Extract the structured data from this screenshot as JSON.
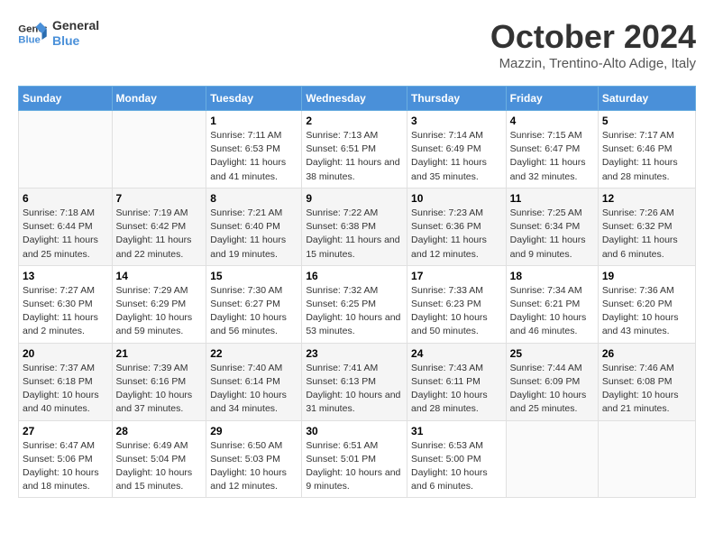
{
  "logo": {
    "line1": "General",
    "line2": "Blue"
  },
  "title": "October 2024",
  "location": "Mazzin, Trentino-Alto Adige, Italy",
  "days_header": [
    "Sunday",
    "Monday",
    "Tuesday",
    "Wednesday",
    "Thursday",
    "Friday",
    "Saturday"
  ],
  "weeks": [
    [
      {
        "day": "",
        "info": ""
      },
      {
        "day": "",
        "info": ""
      },
      {
        "day": "1",
        "info": "Sunrise: 7:11 AM\nSunset: 6:53 PM\nDaylight: 11 hours and 41 minutes."
      },
      {
        "day": "2",
        "info": "Sunrise: 7:13 AM\nSunset: 6:51 PM\nDaylight: 11 hours and 38 minutes."
      },
      {
        "day": "3",
        "info": "Sunrise: 7:14 AM\nSunset: 6:49 PM\nDaylight: 11 hours and 35 minutes."
      },
      {
        "day": "4",
        "info": "Sunrise: 7:15 AM\nSunset: 6:47 PM\nDaylight: 11 hours and 32 minutes."
      },
      {
        "day": "5",
        "info": "Sunrise: 7:17 AM\nSunset: 6:46 PM\nDaylight: 11 hours and 28 minutes."
      }
    ],
    [
      {
        "day": "6",
        "info": "Sunrise: 7:18 AM\nSunset: 6:44 PM\nDaylight: 11 hours and 25 minutes."
      },
      {
        "day": "7",
        "info": "Sunrise: 7:19 AM\nSunset: 6:42 PM\nDaylight: 11 hours and 22 minutes."
      },
      {
        "day": "8",
        "info": "Sunrise: 7:21 AM\nSunset: 6:40 PM\nDaylight: 11 hours and 19 minutes."
      },
      {
        "day": "9",
        "info": "Sunrise: 7:22 AM\nSunset: 6:38 PM\nDaylight: 11 hours and 15 minutes."
      },
      {
        "day": "10",
        "info": "Sunrise: 7:23 AM\nSunset: 6:36 PM\nDaylight: 11 hours and 12 minutes."
      },
      {
        "day": "11",
        "info": "Sunrise: 7:25 AM\nSunset: 6:34 PM\nDaylight: 11 hours and 9 minutes."
      },
      {
        "day": "12",
        "info": "Sunrise: 7:26 AM\nSunset: 6:32 PM\nDaylight: 11 hours and 6 minutes."
      }
    ],
    [
      {
        "day": "13",
        "info": "Sunrise: 7:27 AM\nSunset: 6:30 PM\nDaylight: 11 hours and 2 minutes."
      },
      {
        "day": "14",
        "info": "Sunrise: 7:29 AM\nSunset: 6:29 PM\nDaylight: 10 hours and 59 minutes."
      },
      {
        "day": "15",
        "info": "Sunrise: 7:30 AM\nSunset: 6:27 PM\nDaylight: 10 hours and 56 minutes."
      },
      {
        "day": "16",
        "info": "Sunrise: 7:32 AM\nSunset: 6:25 PM\nDaylight: 10 hours and 53 minutes."
      },
      {
        "day": "17",
        "info": "Sunrise: 7:33 AM\nSunset: 6:23 PM\nDaylight: 10 hours and 50 minutes."
      },
      {
        "day": "18",
        "info": "Sunrise: 7:34 AM\nSunset: 6:21 PM\nDaylight: 10 hours and 46 minutes."
      },
      {
        "day": "19",
        "info": "Sunrise: 7:36 AM\nSunset: 6:20 PM\nDaylight: 10 hours and 43 minutes."
      }
    ],
    [
      {
        "day": "20",
        "info": "Sunrise: 7:37 AM\nSunset: 6:18 PM\nDaylight: 10 hours and 40 minutes."
      },
      {
        "day": "21",
        "info": "Sunrise: 7:39 AM\nSunset: 6:16 PM\nDaylight: 10 hours and 37 minutes."
      },
      {
        "day": "22",
        "info": "Sunrise: 7:40 AM\nSunset: 6:14 PM\nDaylight: 10 hours and 34 minutes."
      },
      {
        "day": "23",
        "info": "Sunrise: 7:41 AM\nSunset: 6:13 PM\nDaylight: 10 hours and 31 minutes."
      },
      {
        "day": "24",
        "info": "Sunrise: 7:43 AM\nSunset: 6:11 PM\nDaylight: 10 hours and 28 minutes."
      },
      {
        "day": "25",
        "info": "Sunrise: 7:44 AM\nSunset: 6:09 PM\nDaylight: 10 hours and 25 minutes."
      },
      {
        "day": "26",
        "info": "Sunrise: 7:46 AM\nSunset: 6:08 PM\nDaylight: 10 hours and 21 minutes."
      }
    ],
    [
      {
        "day": "27",
        "info": "Sunrise: 6:47 AM\nSunset: 5:06 PM\nDaylight: 10 hours and 18 minutes."
      },
      {
        "day": "28",
        "info": "Sunrise: 6:49 AM\nSunset: 5:04 PM\nDaylight: 10 hours and 15 minutes."
      },
      {
        "day": "29",
        "info": "Sunrise: 6:50 AM\nSunset: 5:03 PM\nDaylight: 10 hours and 12 minutes."
      },
      {
        "day": "30",
        "info": "Sunrise: 6:51 AM\nSunset: 5:01 PM\nDaylight: 10 hours and 9 minutes."
      },
      {
        "day": "31",
        "info": "Sunrise: 6:53 AM\nSunset: 5:00 PM\nDaylight: 10 hours and 6 minutes."
      },
      {
        "day": "",
        "info": ""
      },
      {
        "day": "",
        "info": ""
      }
    ]
  ]
}
